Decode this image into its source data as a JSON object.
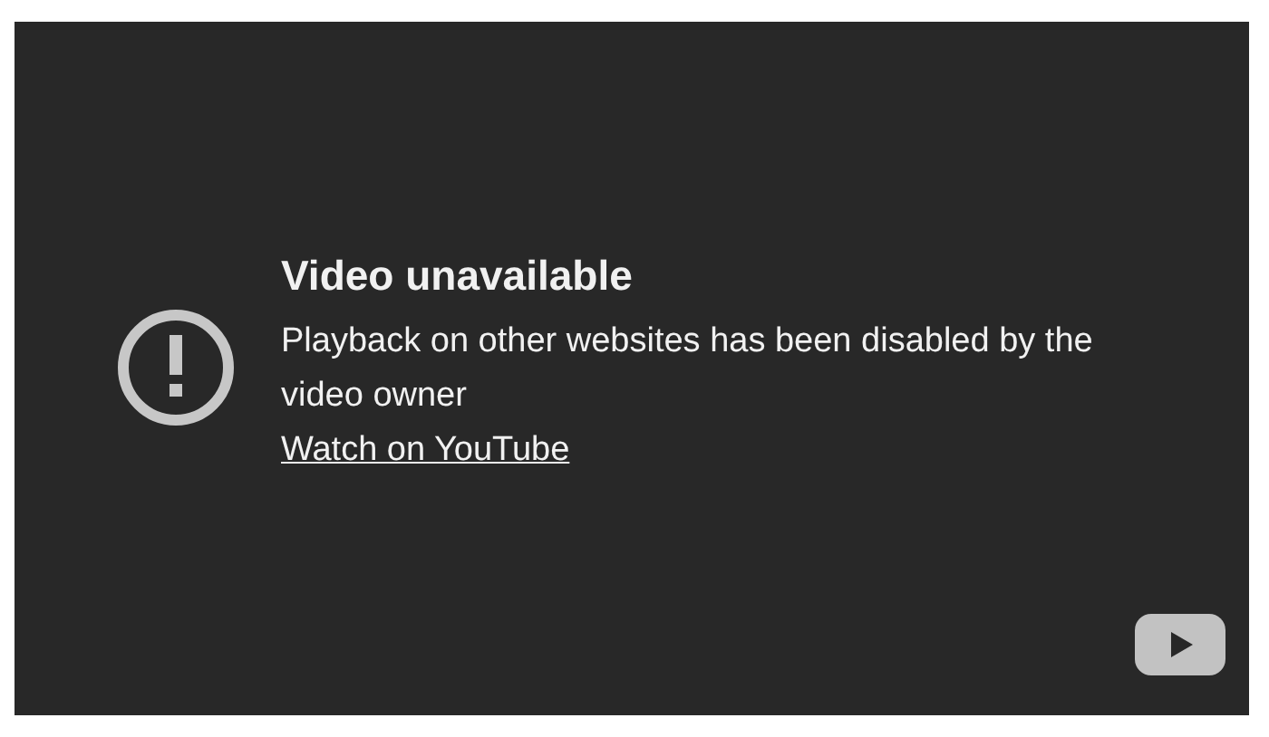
{
  "error": {
    "title": "Video unavailable",
    "message": "Playback on other websites has been disabled by the video owner",
    "link": "Watch on YouTube"
  }
}
